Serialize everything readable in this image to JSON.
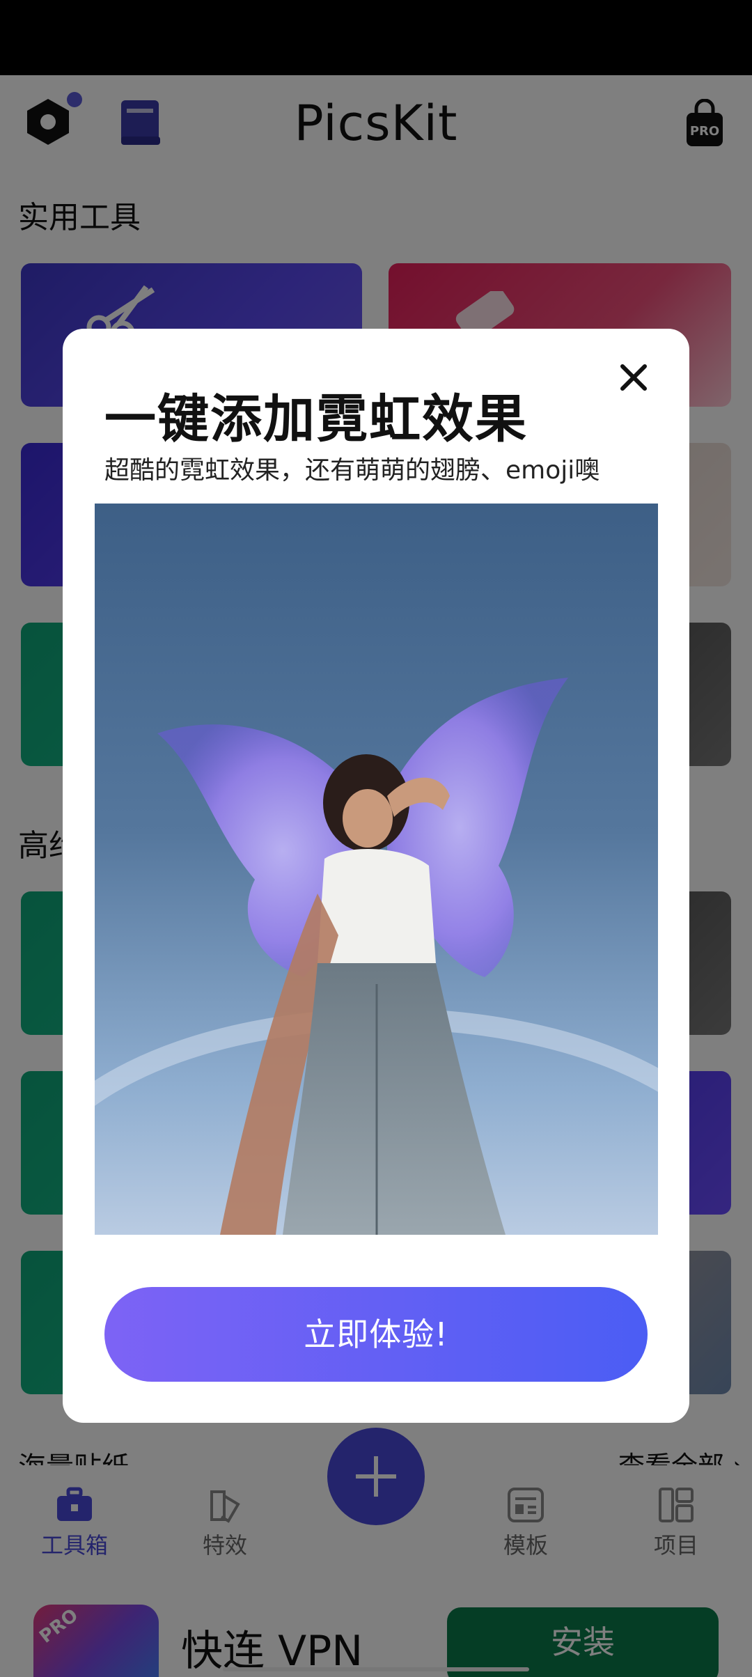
{
  "header": {
    "title": "PicsKit"
  },
  "sections": {
    "tools_title": "实用工具",
    "advanced_title_partial": "高约",
    "stickers_title": "海量贴纸",
    "view_all": "查看全部 ›"
  },
  "bottom_nav": {
    "items": [
      {
        "label": "工具箱",
        "icon": "toolbox-icon",
        "active": true
      },
      {
        "label": "特效",
        "icon": "effects-icon",
        "active": false
      },
      {
        "label": "模板",
        "icon": "template-icon",
        "active": false
      },
      {
        "label": "项目",
        "icon": "project-icon",
        "active": false
      }
    ],
    "add_icon": "plus-icon"
  },
  "ad": {
    "badge": "PRO",
    "name": "快连 VPN",
    "install_label": "安装"
  },
  "modal": {
    "title": "一键添加霓虹效果",
    "subtitle": "超酷的霓虹效果，还有萌萌的翅膀、emoji噢",
    "cta_label": "立即体验!"
  },
  "colors": {
    "accent": "#4848d8",
    "cta_start": "#7d63f5",
    "cta_end": "#4b5df4",
    "install_green": "#0b7a4a"
  }
}
